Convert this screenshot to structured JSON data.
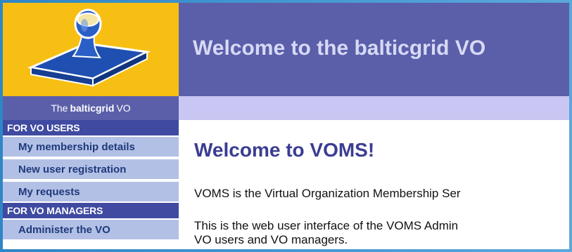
{
  "banner": {
    "title": "Welcome to the balticgrid VO"
  },
  "sidebar": {
    "vo_label_prefix": "The",
    "vo_name": "balticgrid",
    "vo_label_suffix": "VO",
    "sections": [
      {
        "title": "FOR VO USERS",
        "items": [
          "My membership details",
          "New user registration",
          "My requests"
        ]
      },
      {
        "title": "FOR VO MANAGERS",
        "items": [
          "Administer the VO"
        ]
      }
    ]
  },
  "content": {
    "title": "Welcome to VOMS!",
    "paragraph1": "VOMS is the Virtual Organization Membership Ser",
    "paragraph2_line1": "This is the web user interface of the VOMS Admin",
    "paragraph2_line2": "VO users and VO managers."
  },
  "colors": {
    "logo_bg": "#f7bf13",
    "banner_bg": "#5b5fa9",
    "subbar_bg": "#c9c6f3",
    "section_bg": "#3f4aa0",
    "nav_bg": "#b3c0e6",
    "nav_text": "#1f3a7a",
    "title_text": "#3a3d92"
  },
  "icons": {
    "logo": "rubber-stamp-icon"
  }
}
